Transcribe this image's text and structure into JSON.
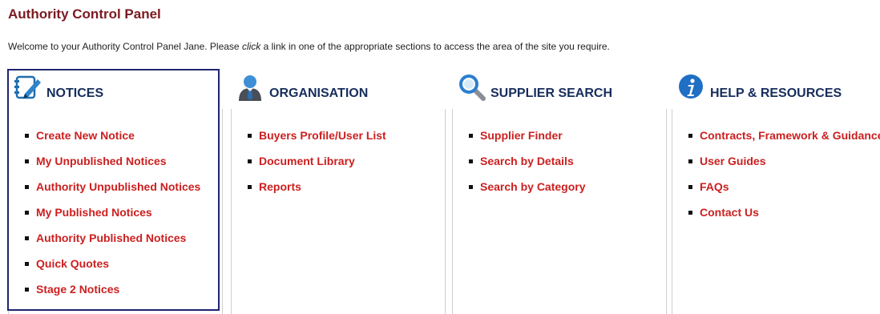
{
  "page": {
    "title": "Authority Control Panel",
    "welcome_before": "Welcome to your Authority Control Panel Jane. Please ",
    "welcome_em": "click",
    "welcome_after": " a link in one of the appropriate sections to access the area of the site you require."
  },
  "sections": [
    {
      "key": "notices",
      "title": "NOTICES",
      "icon": "notepad-pen-icon",
      "links": [
        "Create New Notice",
        "My Unpublished Notices",
        "Authority Unpublished Notices",
        "My Published Notices",
        "Authority Published Notices",
        "Quick Quotes",
        "Stage 2 Notices"
      ]
    },
    {
      "key": "organisation",
      "title": "ORGANISATION",
      "icon": "person-icon",
      "links": [
        "Buyers Profile/User List",
        "Document Library",
        "Reports"
      ]
    },
    {
      "key": "supplier-search",
      "title": "SUPPLIER SEARCH",
      "icon": "magnifier-icon",
      "links": [
        "Supplier Finder",
        "Search by Details",
        "Search by Category"
      ]
    },
    {
      "key": "help-resources",
      "title": "HELP & RESOURCES",
      "icon": "info-icon",
      "links": [
        "Contracts, Framework & Guidance",
        "User Guides",
        "FAQs",
        "Contact Us"
      ]
    }
  ],
  "colors": {
    "title": "#7a1a1f",
    "link": "#cc1f1f",
    "section_heading": "#162d5c",
    "highlight_border": "#1f2470"
  }
}
